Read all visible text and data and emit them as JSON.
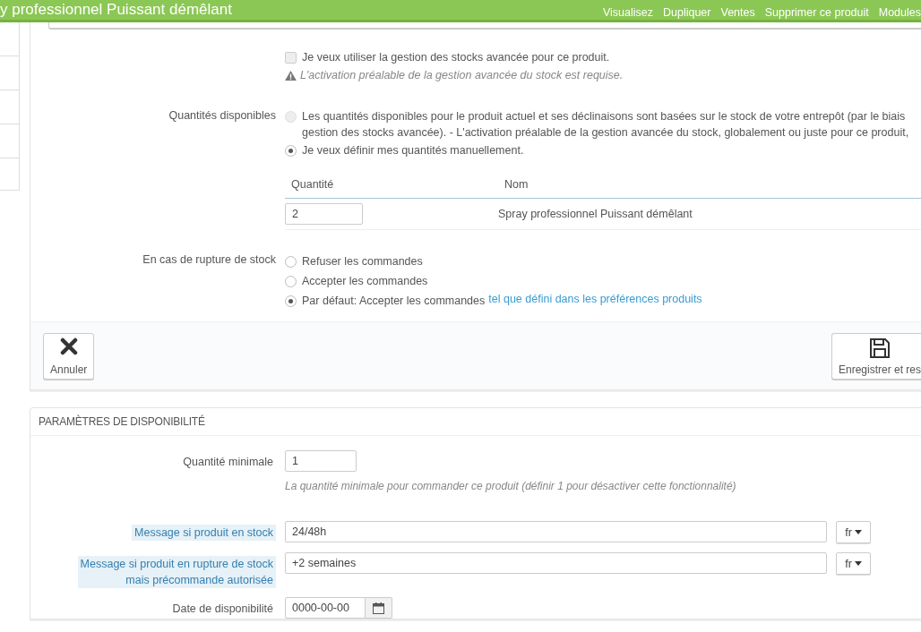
{
  "header": {
    "title": "y professionnel Puissant démêlant",
    "nav": [
      "Visualisez",
      "Dupliquer",
      "Ventes",
      "Supprimer ce produit",
      "Modules"
    ]
  },
  "stock": {
    "advanced": {
      "label": "Je veux utiliser la gestion des stocks avancée pour ce produit.",
      "checked": false,
      "warning": "L'activation préalable de la gestion avancée du stock est requise."
    },
    "available": {
      "label": "Quantités disponibles",
      "options": [
        {
          "lines": [
            "Les quantités disponibles pour le produit actuel et ses déclinaisons sont basées sur le stock de votre entrepôt (par le biais",
            "gestion des stocks avancée).  - L'activation préalable de la gestion avancée du stock, globalement ou juste pour ce produit,"
          ],
          "selected": false,
          "disabled": true
        },
        {
          "lines": [
            "Je veux définir mes quantités manuellement."
          ],
          "selected": true,
          "disabled": false
        }
      ]
    },
    "table": {
      "columns": [
        "Quantité",
        "Nom"
      ],
      "rows": [
        {
          "quantity": "2",
          "name": "Spray professionnel Puissant démêlant"
        }
      ]
    },
    "out_of_stock": {
      "label": "En cas de rupture de stock",
      "options": [
        {
          "text": "Refuser les commandes",
          "selected": false
        },
        {
          "text": "Accepter les commandes",
          "selected": false
        },
        {
          "text": "Par défaut: Accepter les commandes",
          "link": "tel que défini dans les préférences produits",
          "selected": true
        }
      ]
    },
    "footer": {
      "cancel": "Annuler",
      "save": "Enregistrer et res"
    }
  },
  "availability": {
    "title": "PARAMÈTRES DE DISPONIBILITÉ",
    "fields": [
      {
        "kind": "number",
        "label": [
          "Quantité minimale"
        ],
        "value": "1",
        "help": "La quantité minimale pour commander ce produit (définir 1 pour désactiver cette fonctionnalité)",
        "highlighted": false
      },
      {
        "kind": "translatable",
        "label": [
          "Message si produit en stock"
        ],
        "value": "24/48h",
        "lang": "fr",
        "highlighted": true
      },
      {
        "kind": "translatable",
        "label": [
          "Message si produit en rupture de stock",
          "mais précommande autorisée"
        ],
        "value": "+2 semaines",
        "lang": "fr",
        "highlighted": true
      },
      {
        "kind": "date",
        "label": [
          "Date de disponibilité"
        ],
        "value": "0000-00-00",
        "highlighted": false
      }
    ]
  }
}
